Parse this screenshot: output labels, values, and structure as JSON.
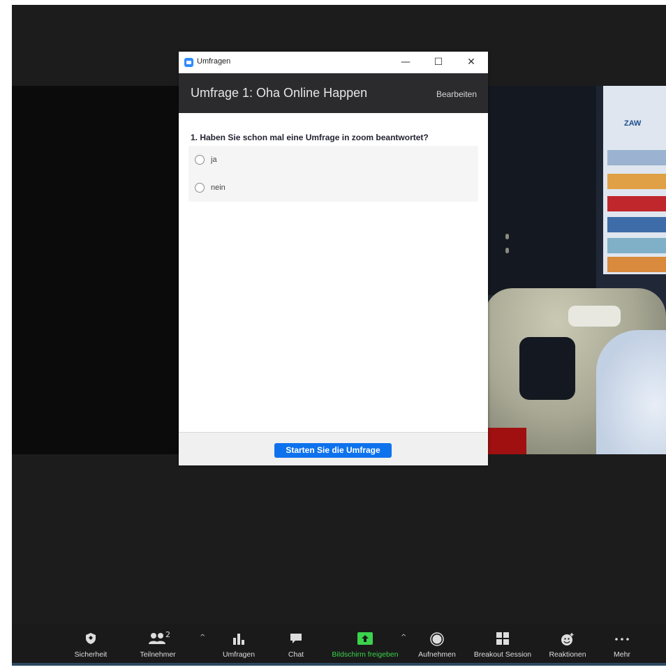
{
  "poll_window": {
    "window_title": "Umfragen",
    "controls": {
      "minimize": "—",
      "maximize": "☐",
      "close": "✕"
    },
    "poll_name": "Umfrage 1: Oha Online Happen",
    "edit_label": "Bearbeiten",
    "question": "1. Haben Sie schon mal eine Umfrage in zoom beantwortet?",
    "options": [
      {
        "label": "ja"
      },
      {
        "label": "nein"
      }
    ],
    "start_button": "Starten Sie die Umfrage"
  },
  "video": {
    "banner_logo": "ZAW"
  },
  "toolbar": {
    "participant_count": "2",
    "items": [
      {
        "label": "Sicherheit",
        "icon": "shield-icon"
      },
      {
        "label": "Teilnehmer",
        "icon": "participants-icon"
      },
      {
        "label": "Umfragen",
        "icon": "poll-icon"
      },
      {
        "label": "Chat",
        "icon": "chat-icon"
      },
      {
        "label": "Bildschirm freigeben",
        "icon": "share-screen-icon"
      },
      {
        "label": "Aufnehmen",
        "icon": "record-icon"
      },
      {
        "label": "Breakout Session",
        "icon": "breakout-icon"
      },
      {
        "label": "Reaktionen",
        "icon": "reactions-icon"
      },
      {
        "label": "Mehr",
        "icon": "more-icon"
      }
    ]
  },
  "colors": {
    "accent": "#0e72ed",
    "share_green": "#3bd34c",
    "header_bg": "#2b2b2d",
    "toolbar_bg": "#1a1a1a"
  }
}
